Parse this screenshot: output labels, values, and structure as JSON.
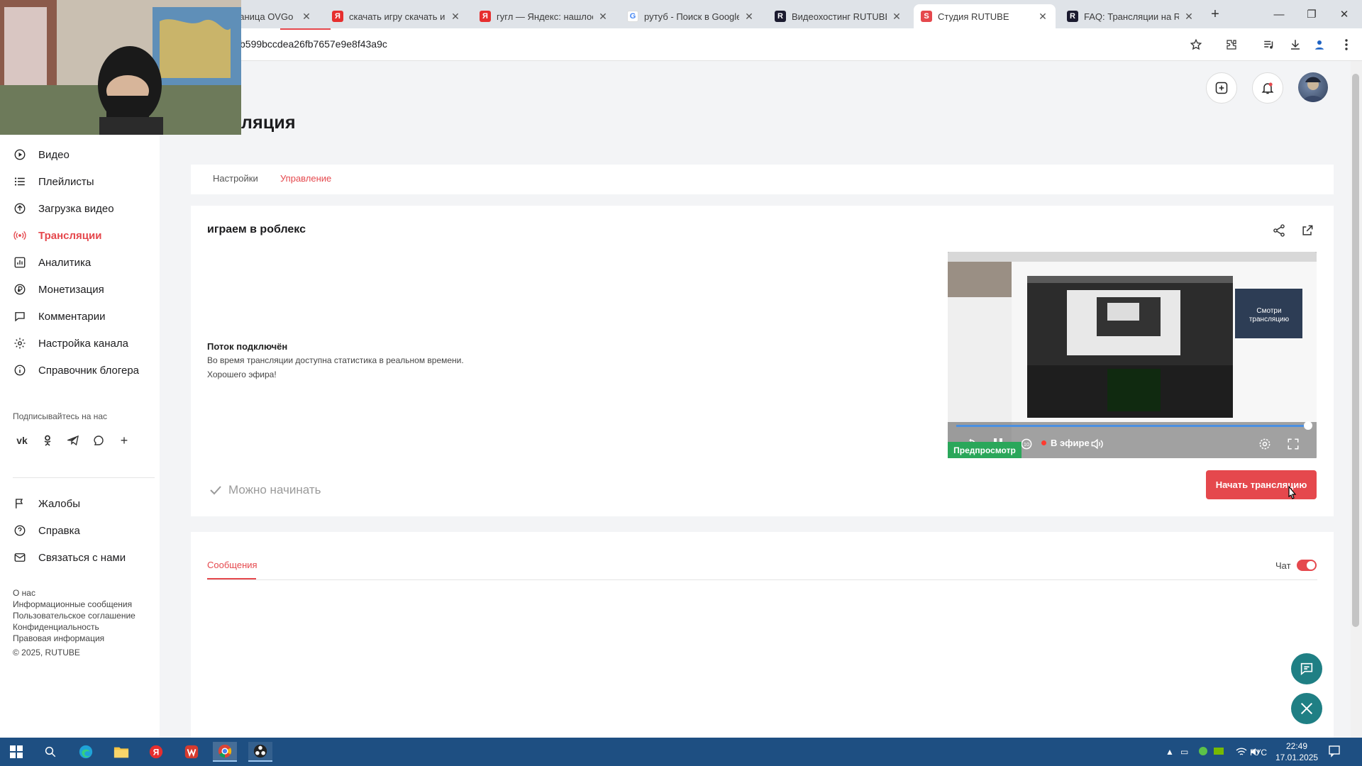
{
  "browser": {
    "tabs": [
      {
        "label": "раница OVGo",
        "favicon": "page"
      },
      {
        "label": "скачать игру скачать игр",
        "favicon": "yandex"
      },
      {
        "label": "гугл — Яндекс: нашлось",
        "favicon": "yandex"
      },
      {
        "label": "рутуб - Поиск в Google",
        "favicon": "google"
      },
      {
        "label": "Видеохостинг RUTUBE. С",
        "favicon": "rutube"
      },
      {
        "label": "Студия RUTUBE",
        "favicon": "studio"
      },
      {
        "label": "FAQ: Трансляции на RU",
        "favicon": "rutube"
      }
    ],
    "active_tab_index": 5,
    "url": "b599bccdea26fb7657e9e8f43a9c"
  },
  "page": {
    "title": "ляция"
  },
  "sidebar": {
    "items": [
      {
        "label": "Видео",
        "icon": "video-icon"
      },
      {
        "label": "Плейлисты",
        "icon": "playlist-icon"
      },
      {
        "label": "Загрузка видео",
        "icon": "upload-icon"
      },
      {
        "label": "Трансляции",
        "icon": "broadcast-icon",
        "active": true
      },
      {
        "label": "Аналитика",
        "icon": "analytics-icon"
      },
      {
        "label": "Монетизация",
        "icon": "monetization-icon"
      },
      {
        "label": "Комментарии",
        "icon": "comments-icon"
      },
      {
        "label": "Настройка канала",
        "icon": "gear-icon"
      },
      {
        "label": "Справочник блогера",
        "icon": "info-icon"
      }
    ],
    "subscribe_heading": "Подписывайтесь на нас",
    "socials": [
      "vk-icon",
      "ok-icon",
      "telegram-icon",
      "viber-icon",
      "more-icon"
    ],
    "support": [
      {
        "label": "Жалобы",
        "icon": "flag-icon"
      },
      {
        "label": "Справка",
        "icon": "help-icon"
      },
      {
        "label": "Связаться с нами",
        "icon": "mail-icon"
      }
    ],
    "footer_links": [
      "О нас",
      "Информационные сообщения",
      "Пользовательское соглашение",
      "Конфиденциальность",
      "Правовая информация"
    ],
    "copyright": "© 2025, RUTUBE"
  },
  "tabs": {
    "settings": "Настройки",
    "manage": "Управление"
  },
  "stream": {
    "title": "играем в роблекс",
    "status_title": "Поток подключён",
    "status_line1": "Во время трансляции доступна статистика в реальном времени.",
    "status_line2": "Хорошего эфира!",
    "ready": "Можно начинать",
    "preview_badge": "Предпросмотр",
    "live_label": "В эфире",
    "start_button": "Начать трансляцию",
    "preview_overlay_text": "Смотри трансляцию"
  },
  "messages": {
    "tab": "Сообщения",
    "chat_label": "Чат",
    "chat_enabled": true
  },
  "taskbar": {
    "lang": "РУС",
    "time": "22:49",
    "date": "17.01.2025"
  },
  "colors": {
    "accent": "#e5484d",
    "preview_badge": "#2aa75a",
    "taskbar": "#1e4f82"
  }
}
